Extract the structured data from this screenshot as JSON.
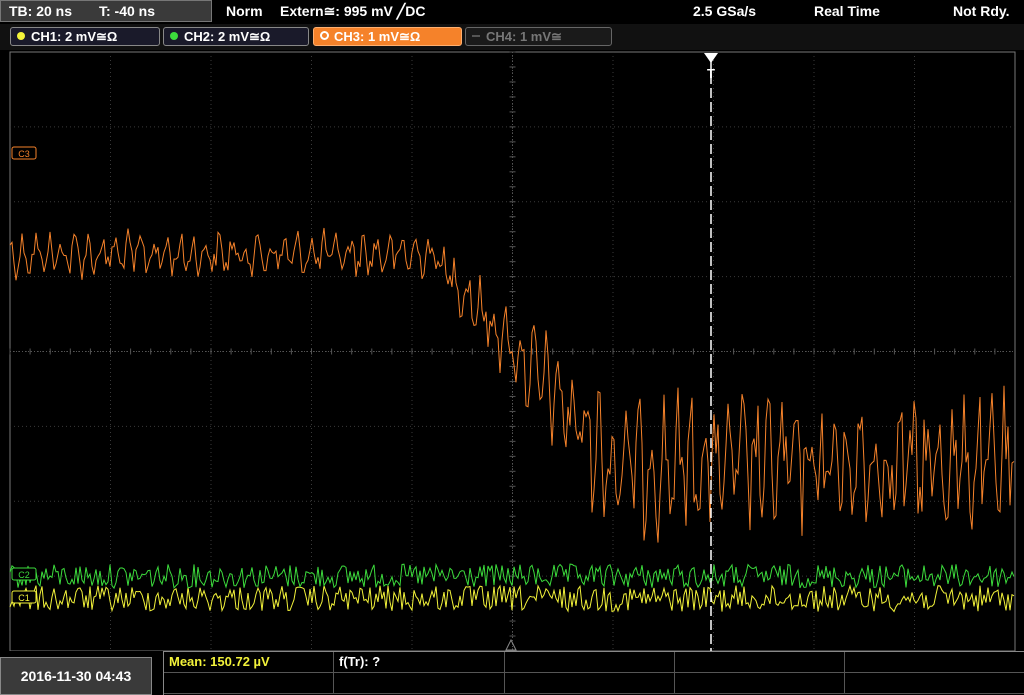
{
  "top": {
    "tb": "TB: 20 ns",
    "t": "T: -40 ns",
    "mode": "Norm",
    "trigger": "Extern≅: 995 mV ╱DC",
    "rate": "2.5 GSa/s",
    "acq": "Real Time",
    "state": "Not Rdy."
  },
  "channels": [
    {
      "label": "CH1: 2 mV≅Ω",
      "color": "#f2f23a",
      "state": "on"
    },
    {
      "label": "CH2: 2 mV≅Ω",
      "color": "#3cdc3c",
      "state": "on"
    },
    {
      "label": "CH3: 1 mV≅Ω",
      "color": "#f5822a",
      "state": "active"
    },
    {
      "label": "CH4: 1 mV≅",
      "color": "#777777",
      "state": "off"
    }
  ],
  "markers": {
    "ch3": "C3",
    "ch2": "C2",
    "ch1": "C1",
    "trigger": "T"
  },
  "footer": {
    "datetime": "2016-11-30 04:43",
    "mean": "Mean: 150.72 µV",
    "ftr": "f(Tr): ?"
  },
  "chart_data": {
    "type": "line",
    "grid": {
      "divisions_x": 10,
      "divisions_y": 8
    },
    "trigger_time_div": 2,
    "series": [
      {
        "channel": "CH3",
        "color": "#f5822a",
        "shape": "step-down with increasing oscillation",
        "level_div_start": 1.3,
        "level_div_end": -1.5
      },
      {
        "channel": "CH2",
        "color": "#3cdc3c",
        "shape": "noise",
        "level_div": -3.0
      },
      {
        "channel": "CH1",
        "color": "#f2f23a",
        "shape": "noise",
        "level_div": -3.3
      }
    ]
  }
}
